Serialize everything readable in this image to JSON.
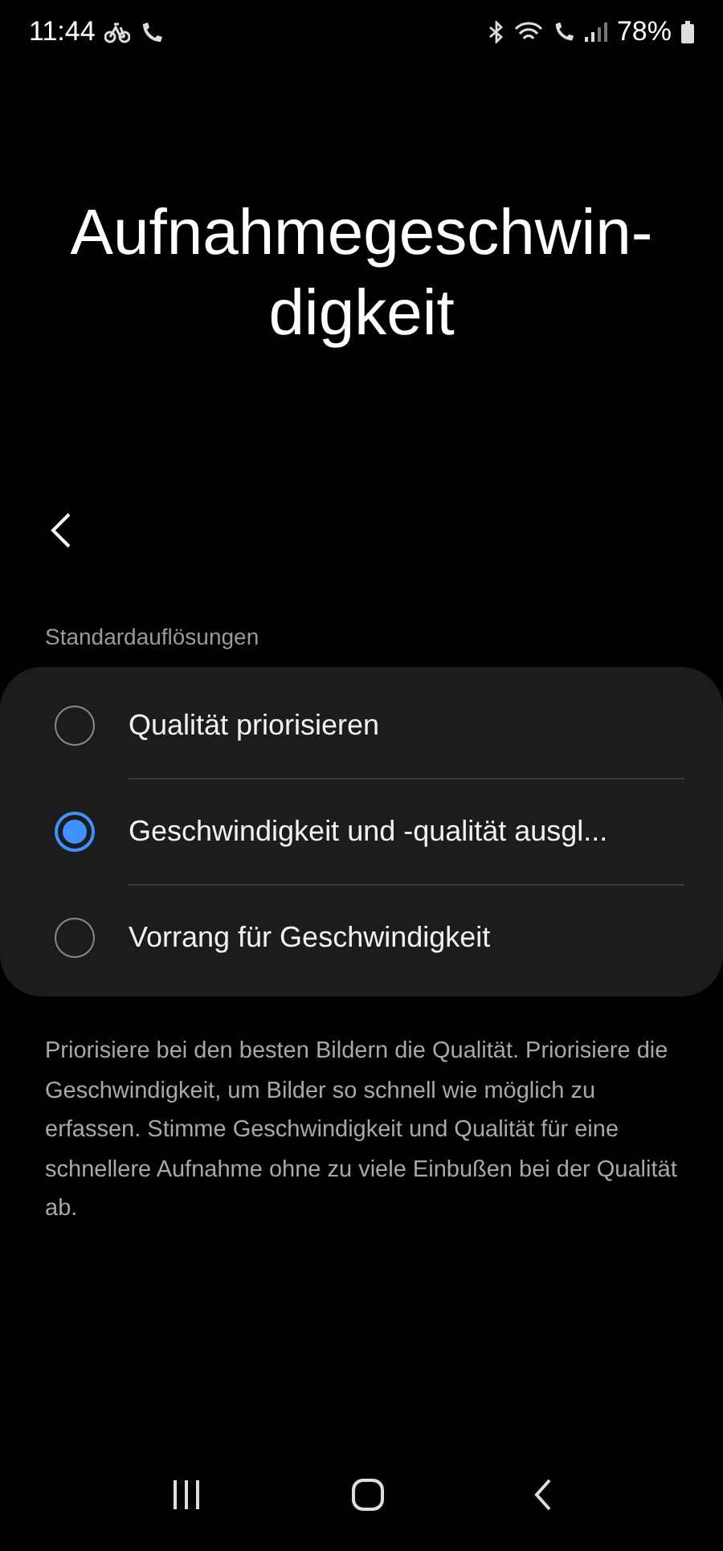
{
  "status_bar": {
    "time": "11:44",
    "battery": "78%"
  },
  "title_lines": [
    "Aufnahmegeschwin-",
    "digkeit"
  ],
  "section_label": "Standardauflösungen",
  "options": [
    {
      "label": "Qualität priorisieren",
      "selected": false
    },
    {
      "label": "Geschwindigkeit und -qualität ausgl...",
      "selected": true
    },
    {
      "label": "Vorrang für Geschwindigkeit",
      "selected": false
    }
  ],
  "description": "Priorisiere bei den besten Bildern die Qualität. Priorisiere die Geschwindigkeit, um Bilder so schnell wie möglich zu erfassen. Stimme Geschwindigkeit und Qualität für eine schnellere Aufnahme ohne zu viele Einbußen bei der Qualität ab."
}
